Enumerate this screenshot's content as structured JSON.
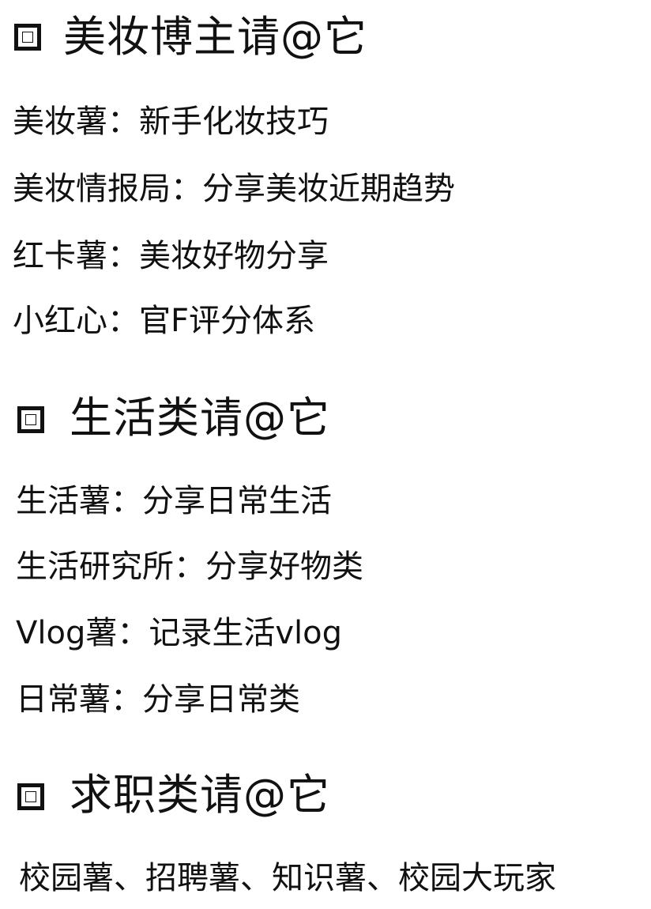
{
  "sections": [
    {
      "heading": "美妆博主请@它",
      "items": [
        "美妆薯：新手化妆技巧",
        "美妆情报局：分享美妆近期趋势",
        "红卡薯：美妆好物分享",
        "小红心：官F评分体系"
      ]
    },
    {
      "heading": "生活类请@它",
      "items": [
        "生活薯：分享日常生活",
        "生活研究所：分享好物类",
        "Vlog薯：记录生活vlog",
        "日常薯：分享日常类"
      ]
    },
    {
      "heading": "求职类请@它",
      "items": [
        "校园薯、招聘薯、知识薯、校园大玩家"
      ]
    }
  ]
}
